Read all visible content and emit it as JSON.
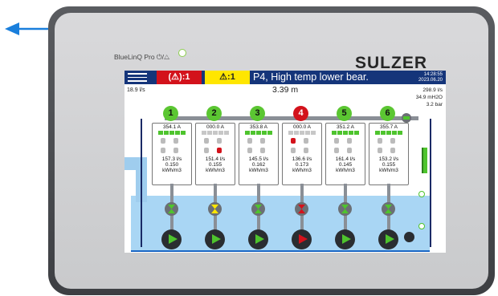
{
  "device": {
    "brand_label": "BlueLinQ Pro",
    "power_icon": "power-icon",
    "alarm_icon": "warning-icon",
    "logo": "SULZER"
  },
  "screen": {
    "alarm_bar": {
      "red_count": ":1",
      "yellow_count": ":1",
      "message": "P4, High temp lower bear.",
      "time": "14:28:55",
      "date": "2023.06.20"
    },
    "inflow": "18.9 l/s",
    "level": "3.39 m",
    "outflow": "298.9 l/s",
    "head": "34.9 mH2O",
    "pressure": "3.2 bar",
    "pumps": [
      {
        "num": "1",
        "current": "354.1 A",
        "flow": "157.3 l/s",
        "energy": "0.150",
        "unit": "kWh/m3",
        "state": "running"
      },
      {
        "num": "2",
        "current": "000.0 A",
        "flow": "151.4 l/s",
        "energy": "0.155",
        "unit": "kWh/m3",
        "state": "warning"
      },
      {
        "num": "3",
        "current": "353.8 A",
        "flow": "145.5 l/s",
        "energy": "0.162",
        "unit": "kWh/m3",
        "state": "running"
      },
      {
        "num": "4",
        "current": "000.0 A",
        "flow": "136.6 l/s",
        "energy": "0.173",
        "unit": "kWh/m3",
        "state": "alarm"
      },
      {
        "num": "5",
        "current": "351.2 A",
        "flow": "161.4 l/s",
        "energy": "0.145",
        "unit": "kWh/m3",
        "state": "running"
      },
      {
        "num": "6",
        "current": "355.7 A",
        "flow": "153.2 l/s",
        "energy": "0.155",
        "unit": "kWh/m3",
        "state": "running"
      }
    ]
  },
  "colors": {
    "bar_blue": "#15357a",
    "alarm_red": "#d3121b",
    "warning_yellow": "#ffe600",
    "running_green": "#4ec42d",
    "water": "#a9d6f4"
  }
}
